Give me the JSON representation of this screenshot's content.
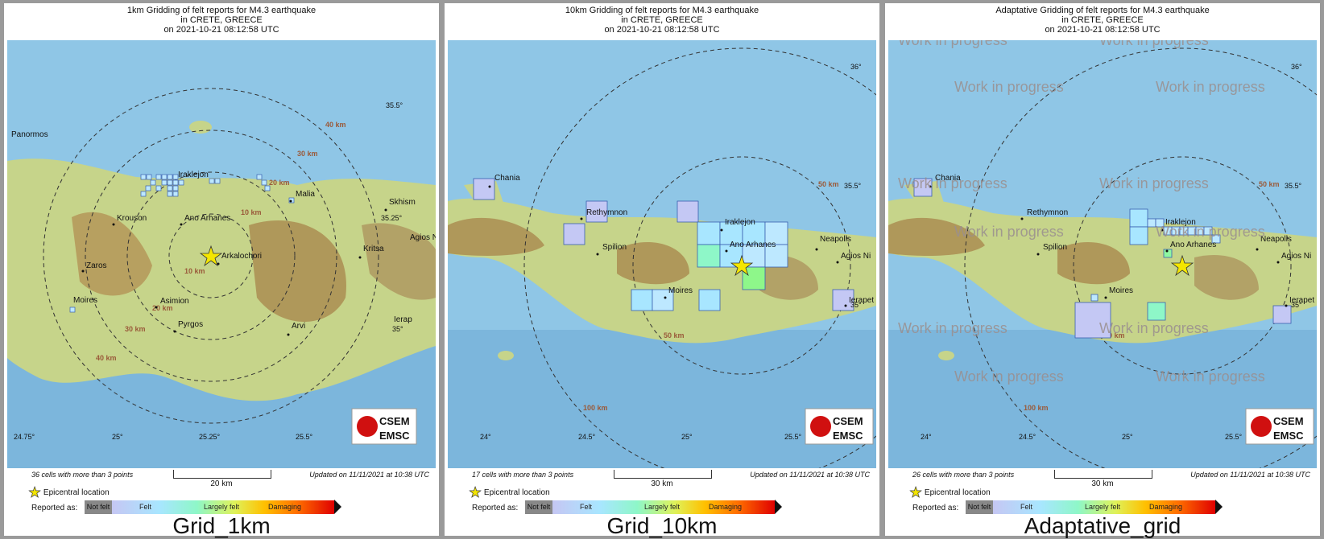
{
  "panels": [
    {
      "title": [
        "1km Gridding of felt reports for M4.3 earthquake",
        "in CRETE, GREECE",
        "on  2021-10-21 08:12:58 UTC"
      ],
      "cells_text": "36 cells with more than 3 points",
      "scale_label": "20 km",
      "updated": "Updated on 11/11/2021 at 10:38 UTC",
      "caption": "Grid_1km",
      "places": [
        "Panormos",
        "Iraklejon",
        "Malia",
        "Krouson",
        "Ano Arhanes",
        "Arkalochori",
        "Zaros",
        "Moires",
        "Asimion",
        "Pyrgos",
        "Arvi",
        "Kritsa",
        "Skhism",
        "Agios N",
        "Ierap"
      ],
      "ring_labels": [
        "10 km",
        "20 km",
        "30 km",
        "40 km",
        "10 km",
        "20 km",
        "30 km",
        "40 km"
      ],
      "lon_ticks": [
        "24.75°",
        "25°",
        "25.25°",
        "25.5°"
      ],
      "lat_ticks": [
        "35.5°",
        "35.25°",
        "35°"
      ]
    },
    {
      "title": [
        "10km Gridding of felt reports for M4.3 earthquake",
        "in CRETE, GREECE",
        "on  2021-10-21 08:12:58 UTC"
      ],
      "cells_text": "17 cells with more than 3 points",
      "scale_label": "30 km",
      "updated": "Updated on 11/11/2021 at 10:38 UTC",
      "caption": "Grid_10km",
      "places": [
        "Chania",
        "Rethymnon",
        "Spilion",
        "Iraklejon",
        "Ano Arhanes",
        "Moires",
        "Neapolis",
        "Agios Ni",
        "Ierapet"
      ],
      "ring_labels": [
        "50 km",
        "50 km",
        "100 km"
      ],
      "lon_ticks": [
        "24°",
        "24.5°",
        "25°",
        "25.5°"
      ],
      "lat_ticks": [
        "36°",
        "35.5°",
        "35°"
      ]
    },
    {
      "title": [
        "Adaptative Gridding of felt reports for M4.3 earthquake",
        "in CRETE, GREECE",
        "on  2021-10-21 08:12:58 UTC"
      ],
      "cells_text": "26 cells with more than 3 points",
      "scale_label": "30 km",
      "updated": "Updated on 11/11/2021 at 10:38 UTC",
      "caption": "Adaptative_grid",
      "watermark": "Work in progress",
      "places": [
        "Chania",
        "Rethymnon",
        "Spilion",
        "Iraklejon",
        "Ano Arhanes",
        "Moires",
        "Neapolis",
        "Agios Ni",
        "Ierapet"
      ],
      "ring_labels": [
        "50 km",
        "50 km",
        "100 km"
      ],
      "lon_ticks": [
        "24°",
        "24.5°",
        "25°",
        "25.5°"
      ],
      "lat_ticks": [
        "36°",
        "35.5°",
        "35°"
      ]
    }
  ],
  "legend": {
    "epicentral": "Epicentral location",
    "reported_as": "Reported as:",
    "levels": [
      "Not felt",
      "Felt",
      "Largely felt",
      "Damaging"
    ]
  },
  "logo": {
    "line1": "CSEM",
    "line2": "EMSC"
  },
  "colors": {
    "land_low": "#c8d68a",
    "land_high": "#a0703a",
    "sea": "#8fc6e6",
    "star": "#f4e600"
  }
}
